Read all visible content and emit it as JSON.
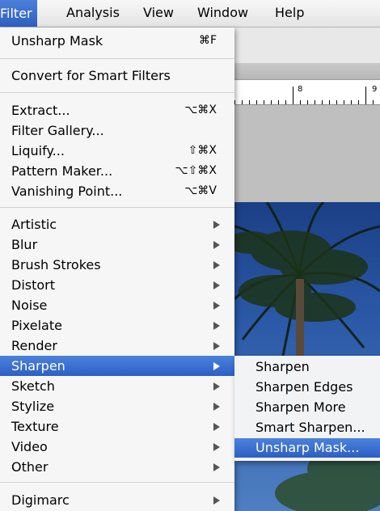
{
  "menubar": {
    "items": [
      "Filter",
      "Analysis",
      "View",
      "Window",
      "Help"
    ]
  },
  "filter_menu": {
    "groups": [
      [
        {
          "label": "Unsharp Mask",
          "shortcut": "⌘F"
        }
      ],
      [
        {
          "label": "Convert for Smart Filters"
        }
      ],
      [
        {
          "label": "Extract...",
          "shortcut": "⌥⌘X"
        },
        {
          "label": "Filter Gallery..."
        },
        {
          "label": "Liquify...",
          "shortcut": "⇧⌘X"
        },
        {
          "label": "Pattern Maker...",
          "shortcut": "⌥⇧⌘X"
        },
        {
          "label": "Vanishing Point...",
          "shortcut": "⌥⌘V"
        }
      ],
      [
        {
          "label": "Artistic"
        },
        {
          "label": "Blur"
        },
        {
          "label": "Brush Strokes"
        },
        {
          "label": "Distort"
        },
        {
          "label": "Noise"
        },
        {
          "label": "Pixelate"
        },
        {
          "label": "Render"
        },
        {
          "label": "Sharpen"
        },
        {
          "label": "Sketch"
        },
        {
          "label": "Stylize"
        },
        {
          "label": "Texture"
        },
        {
          "label": "Video"
        },
        {
          "label": "Other"
        }
      ],
      [
        {
          "label": "Digimarc"
        }
      ]
    ]
  },
  "sharpen_submenu": {
    "items": [
      "Sharpen",
      "Sharpen Edges",
      "Sharpen More",
      "Smart Sharpen...",
      "Unsharp Mask..."
    ]
  },
  "ruler": {
    "labels": [
      "8",
      "9"
    ]
  },
  "colors": {
    "highlight": "#2f5fc2",
    "menu_bg": "#f6f6f6"
  }
}
